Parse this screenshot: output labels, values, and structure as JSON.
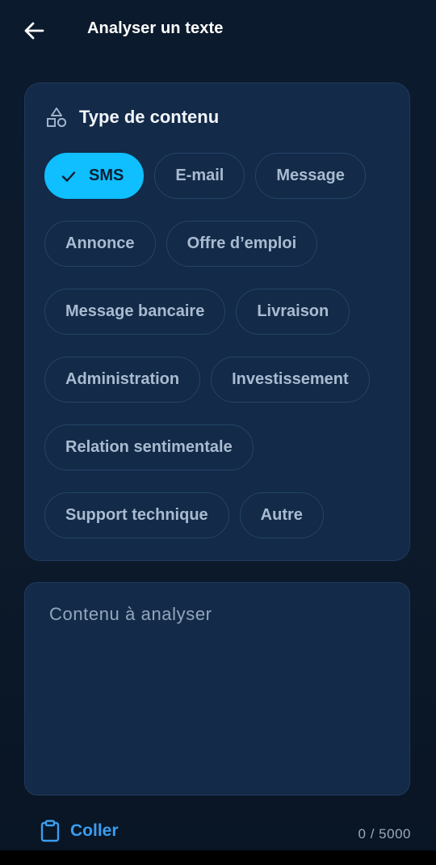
{
  "appbar": {
    "title": "Analyser un texte",
    "back_icon": "arrow-left-icon"
  },
  "content_type": {
    "title": "Type de contenu",
    "icon": "shapes-icon",
    "rows": [
      [
        {
          "label": "SMS",
          "selected": true
        },
        {
          "label": "E-mail",
          "selected": false
        },
        {
          "label": "Message",
          "selected": false
        }
      ],
      [
        {
          "label": "Annonce",
          "selected": false
        },
        {
          "label": "Offre d’emploi",
          "selected": false
        }
      ],
      [
        {
          "label": "Message bancaire",
          "selected": false
        },
        {
          "label": "Livraison",
          "selected": false
        }
      ],
      [
        {
          "label": "Administration",
          "selected": false
        },
        {
          "label": "Investissement",
          "selected": false
        }
      ],
      [
        {
          "label": "Relation sentimentale",
          "selected": false
        }
      ],
      [
        {
          "label": "Support technique",
          "selected": false
        },
        {
          "label": "Autre",
          "selected": false
        }
      ]
    ]
  },
  "content_input": {
    "placeholder": "Contenu à analyser",
    "value": ""
  },
  "footer": {
    "paste_label": "Coller",
    "paste_icon": "clipboard-icon",
    "char_count": "0 / 5000"
  },
  "colors": {
    "background": "#0b1a2c",
    "card": "#132a48",
    "accent": "#0fbfff",
    "link": "#3a9df0"
  }
}
